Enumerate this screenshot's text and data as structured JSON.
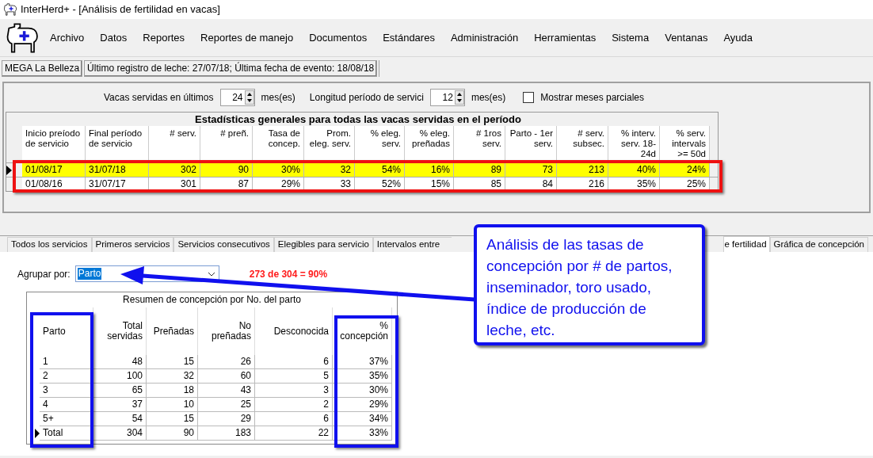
{
  "window": {
    "title": "InterHerd+ - [Análisis de fertilidad en vacas]"
  },
  "menu": [
    "Archivo",
    "Datos",
    "Reportes",
    "Reportes de manejo",
    "Documentos",
    "Estándares",
    "Administración",
    "Herramientas",
    "Sistema",
    "Ventanas",
    "Ayuda"
  ],
  "status": [
    "MEGA La Belleza",
    "Último registro de leche: 27/07/18; Última fecha de evento: 18/08/18"
  ],
  "filters": {
    "months_label": "Vacas servidas en últimos",
    "months_value": "24",
    "months_unit": "mes(es)",
    "period_label": "Longitud período de servici",
    "period_value": "12",
    "period_unit": "mes(es)",
    "partial": {
      "label": "Mostrar meses parciales",
      "checked": false
    }
  },
  "stats_grid": {
    "title": "Estadísticas generales para todas las vacas servidas en el período",
    "columns": [
      "Inicio preíodo de servicio",
      "Final período de servicio",
      "# serv.",
      "# preñ.",
      "Tasa de concep.",
      "Prom. eleg. serv.",
      "% eleg. serv.",
      "% eleg. preñadas",
      "# 1ros serv.",
      "Parto - 1er serv.",
      "# serv. subsec.",
      "% interv. serv. 18-24d",
      "% serv. intervals >= 50d"
    ],
    "rows": [
      {
        "selected": true,
        "cells": [
          "01/08/17",
          "31/07/18",
          "302",
          "90",
          "30%",
          "32",
          "54%",
          "16%",
          "89",
          "73",
          "213",
          "40%",
          "24%"
        ]
      },
      {
        "selected": false,
        "cells": [
          "01/08/16",
          "31/07/17",
          "301",
          "87",
          "29%",
          "33",
          "52%",
          "15%",
          "85",
          "84",
          "216",
          "35%",
          "25%"
        ]
      }
    ]
  },
  "tabs": [
    {
      "label": "Todos los servicios",
      "selected": false
    },
    {
      "label": "Primeros servicios",
      "selected": false
    },
    {
      "label": "Servicios consecutivos",
      "selected": false
    },
    {
      "label": "Elegibles para servicio",
      "selected": false
    },
    {
      "label": "Intervalos entre",
      "selected": false
    },
    {
      "label": "e fertilidad",
      "selected": true
    },
    {
      "label": "Gráfica de concepción",
      "selected": false
    }
  ],
  "group_by": {
    "label": "Agrupar por:",
    "value": "Parto"
  },
  "summary_note": "273 de 304 = 90%",
  "summary_table": {
    "title": "Resumen de concepción por No. del parto",
    "columns": [
      "Parto",
      "Total servidas",
      "Preñadas",
      "No preñadas",
      "Desconocida",
      "% concepción"
    ],
    "rows": [
      {
        "selected": false,
        "cells": [
          "1",
          "48",
          "15",
          "26",
          "6",
          "37%"
        ]
      },
      {
        "selected": false,
        "cells": [
          "2",
          "100",
          "32",
          "60",
          "5",
          "35%"
        ]
      },
      {
        "selected": false,
        "cells": [
          "3",
          "65",
          "18",
          "43",
          "3",
          "30%"
        ]
      },
      {
        "selected": false,
        "cells": [
          "4",
          "37",
          "10",
          "25",
          "2",
          "29%"
        ]
      },
      {
        "selected": false,
        "cells": [
          "5+",
          "54",
          "15",
          "29",
          "6",
          "34%"
        ]
      },
      {
        "selected": true,
        "cells": [
          "Total",
          "304",
          "90",
          "183",
          "22",
          "33%"
        ]
      }
    ]
  },
  "callout": "Análisis de las tasas de concepción por # de partos, inseminador, toro usado, índice de producción de leche, etc."
}
